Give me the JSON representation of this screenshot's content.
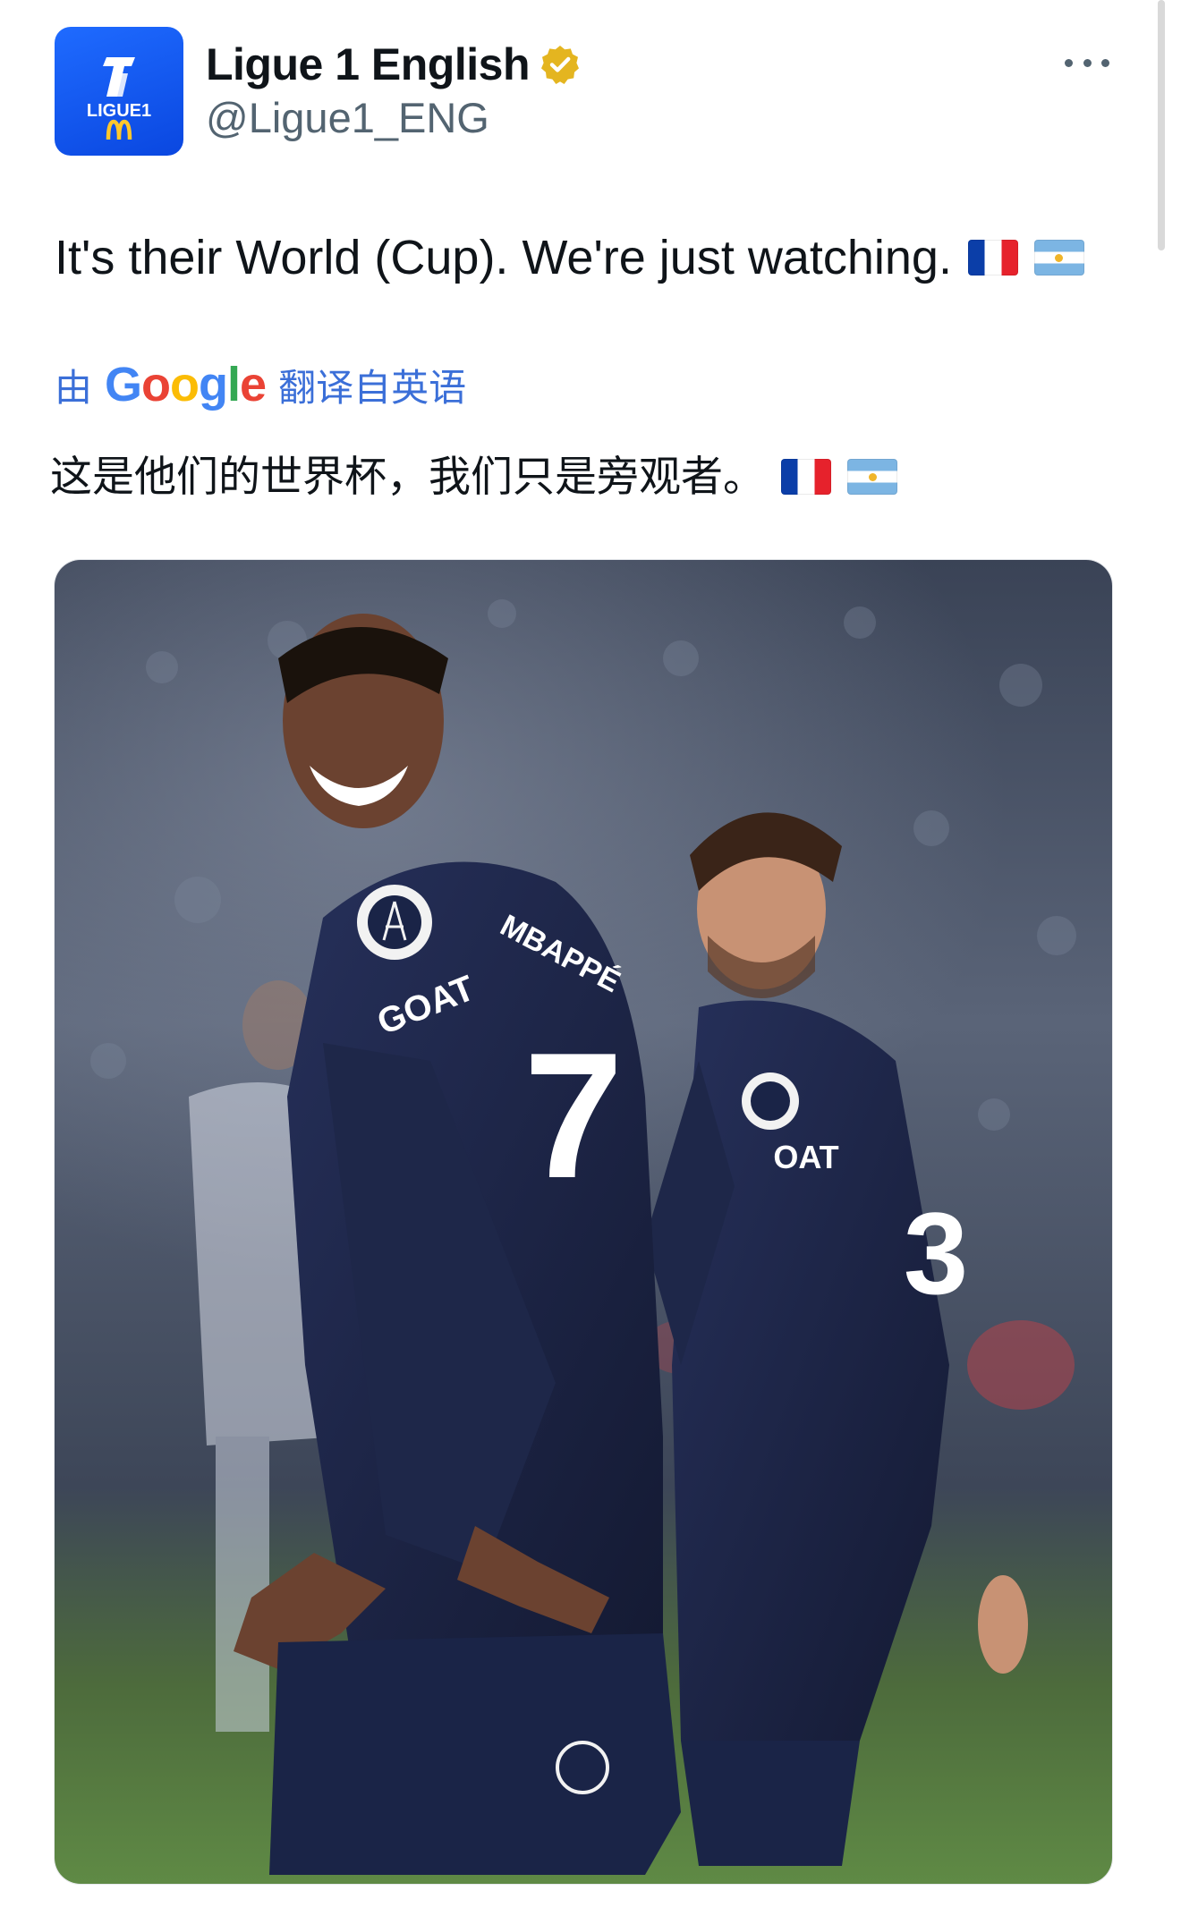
{
  "tweet": {
    "author": {
      "display_name": "Ligue 1 English",
      "handle": "@Ligue1_ENG",
      "verified": true,
      "avatar_text": {
        "line1": "LIGUE1"
      },
      "brand_color": "#0a47e0"
    },
    "text": "It's their World (Cup). We're just watching.",
    "emoji": [
      "france-flag",
      "argentina-flag"
    ],
    "translation": {
      "prefix": "由",
      "provider": "Google",
      "suffix": "翻译自英语",
      "text": "这是他们的世界杯，我们只是旁观者。"
    },
    "media": {
      "jersey_text_left": "GOAT",
      "jersey_name_left": "MBAPPÉ",
      "jersey_number_left": "7",
      "jersey_text_right": "OAT",
      "jersey_number_right": "3",
      "jersey_color": "#1a2447"
    }
  }
}
